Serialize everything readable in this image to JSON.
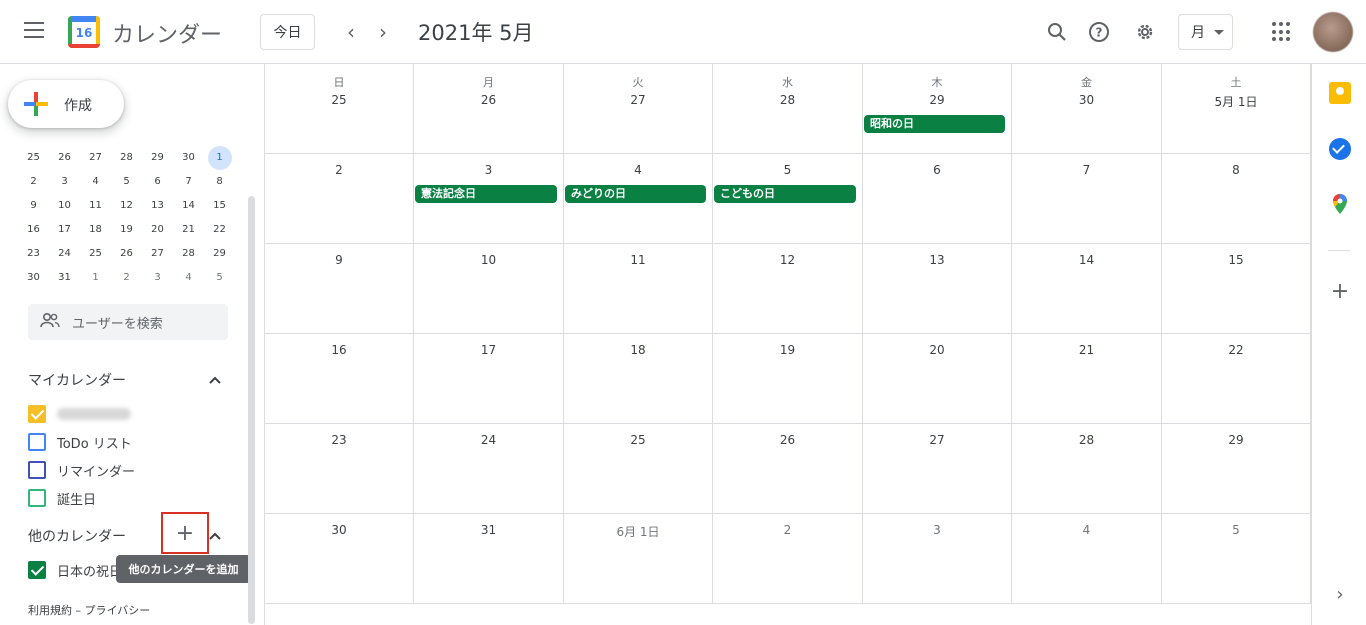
{
  "header": {
    "app_title": "カレンダー",
    "logo_number": "16",
    "today_label": "今日",
    "prev_glyph": "‹",
    "next_glyph": "›",
    "current_date": "2021年 5月",
    "view_label": "月",
    "icons": [
      "menu-icon",
      "search-icon",
      "help-icon",
      "settings-icon",
      "apps-icon"
    ]
  },
  "sidebar": {
    "create_label": "作成",
    "mini_calendar": [
      [
        "25",
        "26",
        "27",
        "28",
        "29",
        "30",
        "1"
      ],
      [
        "2",
        "3",
        "4",
        "5",
        "6",
        "7",
        "8"
      ],
      [
        "9",
        "10",
        "11",
        "12",
        "13",
        "14",
        "15"
      ],
      [
        "16",
        "17",
        "18",
        "19",
        "20",
        "21",
        "22"
      ],
      [
        "23",
        "24",
        "25",
        "26",
        "27",
        "28",
        "29"
      ],
      [
        "30",
        "31",
        "1",
        "2",
        "3",
        "4",
        "5"
      ]
    ],
    "people_search_placeholder": "ユーザーを検索",
    "my_calendars_title": "マイカレンダー",
    "my_calendars": [
      {
        "label": "",
        "color": "#f6bf26",
        "checked": true
      },
      {
        "label": "ToDo リスト",
        "color": "#4285f4",
        "checked": false
      },
      {
        "label": "リマインダー",
        "color": "#3f51b5",
        "checked": false
      },
      {
        "label": "誕生日",
        "color": "#33b679",
        "checked": false
      }
    ],
    "other_calendars_title": "他のカレンダー",
    "other_calendars": [
      {
        "label": "日本の祝日",
        "color": "#0b8043",
        "checked": true
      }
    ],
    "add_other_tooltip": "他のカレンダーを追加",
    "footer": "利用規約 – プライバシー"
  },
  "calendar": {
    "weekdays": [
      "日",
      "月",
      "火",
      "水",
      "木",
      "金",
      "土"
    ],
    "weeks": [
      [
        {
          "date": "25",
          "other": false
        },
        {
          "date": "26",
          "other": false
        },
        {
          "date": "27",
          "other": false
        },
        {
          "date": "28",
          "other": false
        },
        {
          "date": "29",
          "other": false,
          "event": "昭和の日"
        },
        {
          "date": "30",
          "other": false
        },
        {
          "date": "5月 1日",
          "other": false
        }
      ],
      [
        {
          "date": "2",
          "other": false
        },
        {
          "date": "3",
          "other": false,
          "event": "憲法記念日"
        },
        {
          "date": "4",
          "other": false,
          "event": "みどりの日"
        },
        {
          "date": "5",
          "other": false,
          "event": "こどもの日"
        },
        {
          "date": "6",
          "other": false
        },
        {
          "date": "7",
          "other": false
        },
        {
          "date": "8",
          "other": false
        }
      ],
      [
        {
          "date": "9"
        },
        {
          "date": "10"
        },
        {
          "date": "11"
        },
        {
          "date": "12"
        },
        {
          "date": "13"
        },
        {
          "date": "14"
        },
        {
          "date": "15"
        }
      ],
      [
        {
          "date": "16"
        },
        {
          "date": "17"
        },
        {
          "date": "18"
        },
        {
          "date": "19"
        },
        {
          "date": "20"
        },
        {
          "date": "21"
        },
        {
          "date": "22"
        }
      ],
      [
        {
          "date": "23"
        },
        {
          "date": "24"
        },
        {
          "date": "25"
        },
        {
          "date": "26"
        },
        {
          "date": "27"
        },
        {
          "date": "28"
        },
        {
          "date": "29"
        }
      ],
      [
        {
          "date": "30"
        },
        {
          "date": "31"
        },
        {
          "date": "6月 1日",
          "other": true
        },
        {
          "date": "2",
          "other": true
        },
        {
          "date": "3",
          "other": true
        },
        {
          "date": "4",
          "other": true
        },
        {
          "date": "5",
          "other": true
        }
      ]
    ]
  },
  "right_rail": {
    "icons": [
      "keep-icon",
      "tasks-icon",
      "maps-icon",
      "add-addon-icon"
    ]
  },
  "colors": {
    "holiday_green": "#0b8043",
    "accent_blue": "#1a73e8",
    "highlight_red": "#d93025"
  }
}
